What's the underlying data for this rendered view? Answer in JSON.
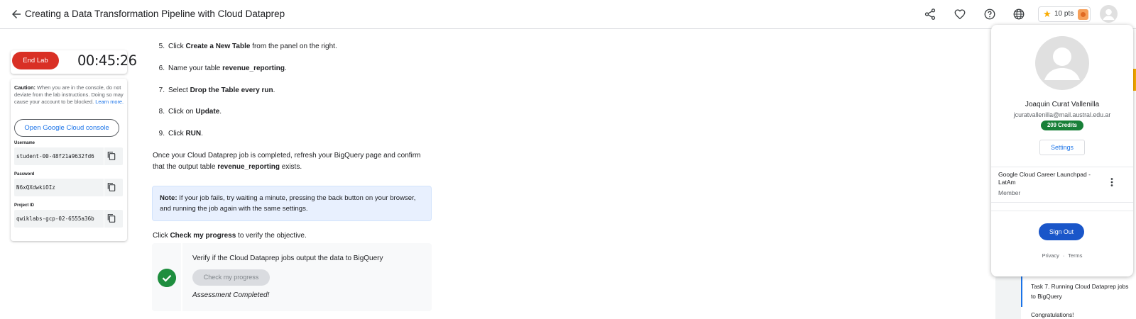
{
  "header": {
    "title": "Creating a Data Transformation Pipeline with Cloud Dataprep",
    "points_label": "10 pts",
    "icons": [
      "back-arrow-icon",
      "share-icon",
      "heart-icon",
      "help-icon",
      "globe-icon",
      "star-icon",
      "badge-icon",
      "avatar-icon"
    ]
  },
  "lab": {
    "end_label": "End Lab",
    "timer": "00:45:26",
    "caution_title": "Caution:",
    "caution_text": "When you are in the console, do not deviate from the lab instructions. Doing so may cause your account to be blocked.",
    "learn_more": "Learn more.",
    "console_button": "Open Google Cloud console",
    "username_label": "Username",
    "username_value": "student-00-48f21a9632fd6",
    "password_label": "Password",
    "password_value": "N6xQXdwkiOIz",
    "project_label": "Project ID",
    "project_value": "qwiklabs-gcp-02-6555a36b"
  },
  "content": {
    "steps": [
      {
        "num": "5.",
        "pre": "Click ",
        "bold": "Create a New Table",
        "post": " from the panel on the right."
      },
      {
        "num": "6.",
        "pre": "Name your table ",
        "bold": "revenue_reporting",
        "post": "."
      },
      {
        "num": "7.",
        "pre": "Select ",
        "bold": "Drop the Table every run",
        "post": "."
      },
      {
        "num": "8.",
        "pre": "Click on ",
        "bold": "Update",
        "post": "."
      },
      {
        "num": "9.",
        "pre": "Click ",
        "bold": "RUN",
        "post": "."
      }
    ],
    "completed_pre": "Once your Cloud Dataprep job is completed, refresh your BigQuery page and confirm that the output table ",
    "completed_bold": "revenue_reporting",
    "completed_post": " exists.",
    "note_bold": "Note:",
    "note_text": " If your job fails, try waiting a minute, pressing the back button on your browser, and running the job again with the same settings.",
    "progress_pre": "Click ",
    "progress_bold": "Check my progress",
    "progress_post": " to verify the objective.",
    "verify_text": "Verify if the Cloud Dataprep jobs output the data to BigQuery",
    "check_button": "Check my progress",
    "assessment": "Assessment Completed!"
  },
  "toc": {
    "task7": "Task 7. Running Cloud Dataprep jobs to BigQuery",
    "congrats": "Congratulations!"
  },
  "account": {
    "name": "Joaquin Curat Vallenilla",
    "email": "jcuratvallenilla@mail.austral.edu.ar",
    "credits": "209 Credits",
    "settings": "Settings",
    "org": "Google Cloud Career Launchpad - LatAm",
    "role": "Member",
    "sign_out": "Sign Out",
    "privacy": "Privacy",
    "separator": "·",
    "terms": "Terms"
  },
  "colors": {
    "end_lab": "#d93025",
    "link": "#1a73e8",
    "credits": "#188038",
    "sign_out": "#1a56c9",
    "note_bg": "#e8f0fe",
    "check_green": "#1e8e3e"
  }
}
